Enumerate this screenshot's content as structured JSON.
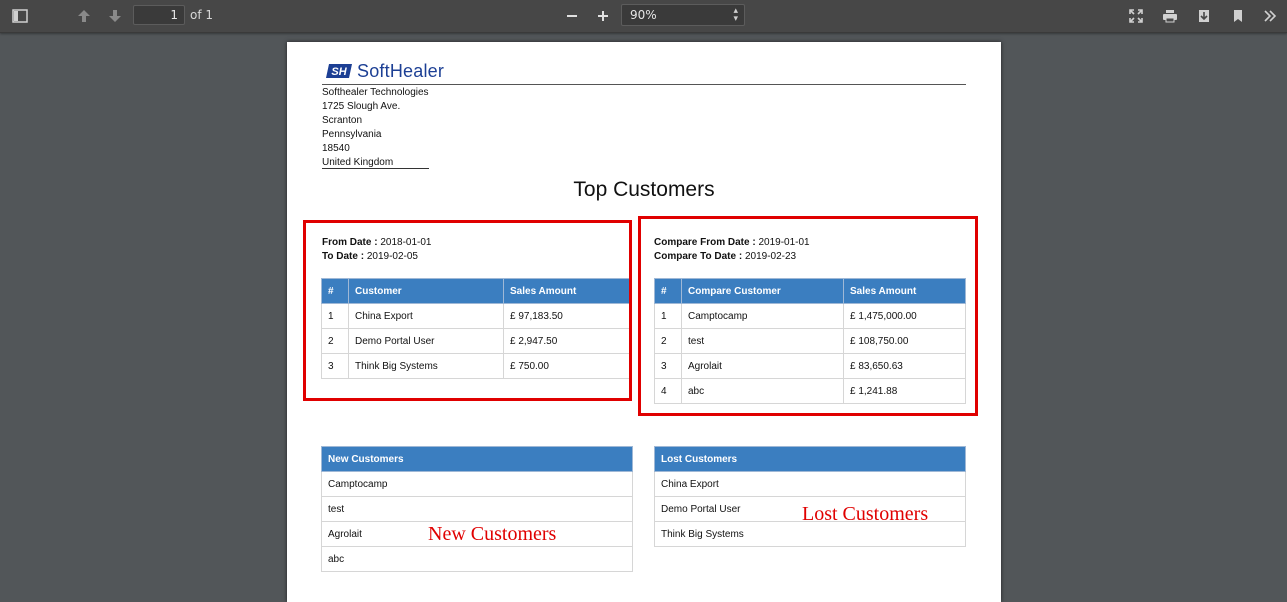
{
  "toolbar": {
    "current_page": "1",
    "page_of": "of 1",
    "zoom": "90%",
    "icons": [
      "sidebar-toggle-icon",
      "arrow-up-icon",
      "arrow-down-icon",
      "minus-icon",
      "plus-icon",
      "fullscreen-icon",
      "print-icon",
      "download-icon",
      "bookmark-icon",
      "double-chevron-right-icon"
    ]
  },
  "company": {
    "logo_text": "SoftHealer",
    "logo_mark": "SH",
    "address": [
      "Softhealer Technologies",
      "1725 Slough Ave.",
      "Scranton",
      "Pennsylvania",
      "18540",
      "United Kingdom"
    ]
  },
  "report": {
    "title": "Top Customers",
    "left": {
      "from_label": "From Date :",
      "from_value": "2018-01-01",
      "to_label": "To Date :",
      "to_value": "2019-02-05",
      "headers": [
        "#",
        "Customer",
        "Sales Amount"
      ],
      "rows": [
        [
          "1",
          "China Export",
          "£ 97,183.50"
        ],
        [
          "2",
          "Demo Portal User",
          "£ 2,947.50"
        ],
        [
          "3",
          "Think Big Systems",
          "£ 750.00"
        ]
      ]
    },
    "right": {
      "from_label": "Compare From Date :",
      "from_value": "2019-01-01",
      "to_label": "Compare To Date :",
      "to_value": "2019-02-23",
      "headers": [
        "#",
        "Compare Customer",
        "Sales Amount"
      ],
      "rows": [
        [
          "1",
          "Camptocamp",
          "£ 1,475,000.00"
        ],
        [
          "2",
          "test",
          "£ 108,750.00"
        ],
        [
          "3",
          "Agrolait",
          "£ 83,650.63"
        ],
        [
          "4",
          "abc",
          "£ 1,241.88"
        ]
      ]
    },
    "new_customers": {
      "header": "New Customers",
      "rows": [
        "Camptocamp",
        "test",
        "Agrolait",
        "abc"
      ]
    },
    "lost_customers": {
      "header": "Lost Customers",
      "rows": [
        "China Export",
        "Demo Portal User",
        "Think Big Systems"
      ]
    }
  },
  "annotations": {
    "new_label": "New Customers",
    "lost_label": "Lost Customers",
    "color": "#e00000"
  }
}
